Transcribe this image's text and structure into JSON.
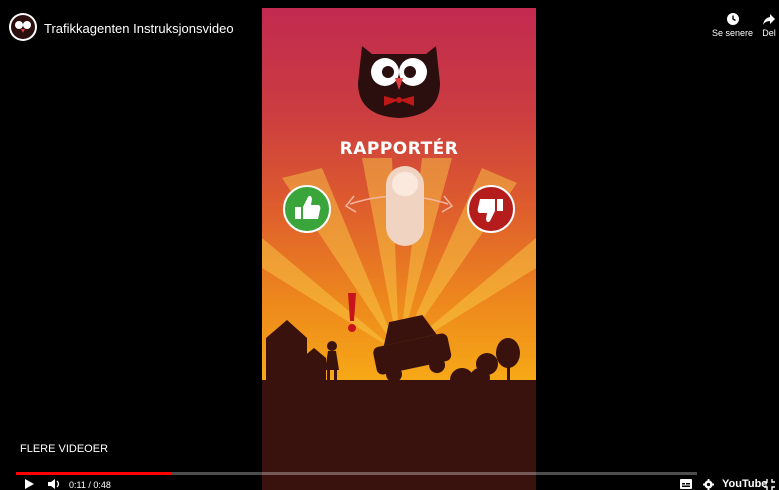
{
  "video": {
    "title": "Trafikkagenten Instruksjonsvideo",
    "channel_icon": "owl-logo-icon"
  },
  "top_actions": {
    "watch_later_label": "Se senere",
    "share_label": "Del"
  },
  "overlay": {
    "more_videos_label": "FLERE VIDEOER"
  },
  "app_screen": {
    "headline": "RAPPORTÉR",
    "left_button": "thumbs-up-icon",
    "right_button": "thumbs-down-icon",
    "gesture": "swipe-finger-icon",
    "colors": {
      "top": "#c22a50",
      "bottom": "#f7aa16",
      "green": "#3aa53a",
      "red": "#b51c1c",
      "silhouette": "#3a120d"
    }
  },
  "controls": {
    "time": "0:11 / 0:48",
    "progress_fraction": 0.229,
    "play_icon": "play-icon",
    "volume_icon": "volume-icon",
    "captions_icon": "subtitles-icon",
    "settings_icon": "gear-icon",
    "brand": "YouTube",
    "fullscreen_icon": "exit-fullscreen-icon"
  }
}
